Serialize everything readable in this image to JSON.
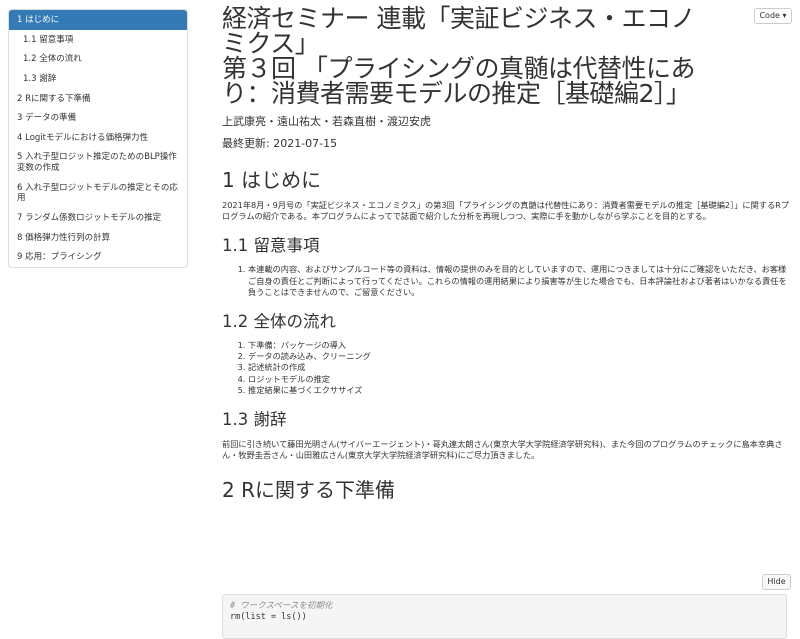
{
  "toc": {
    "items": [
      {
        "label": "1 はじめに",
        "sub": false,
        "active": true
      },
      {
        "label": "1.1 留意事項",
        "sub": true,
        "active": false
      },
      {
        "label": "1.2 全体の流れ",
        "sub": true,
        "active": false
      },
      {
        "label": "1.3 謝辞",
        "sub": true,
        "active": false
      },
      {
        "label": "2 Rに関する下準備",
        "sub": false,
        "active": false
      },
      {
        "label": "3 データの準備",
        "sub": false,
        "active": false
      },
      {
        "label": "4 Logitモデルにおける価格弾力性",
        "sub": false,
        "active": false
      },
      {
        "label": "5 入れ子型ロジット推定のためのBLP操作変数の作成",
        "sub": false,
        "active": false
      },
      {
        "label": "6 入れ子型ロジットモデルの推定とその応用",
        "sub": false,
        "active": false
      },
      {
        "label": "7 ランダム係数ロジットモデルの推定",
        "sub": false,
        "active": false
      },
      {
        "label": "8 価格弾力性行列の計算",
        "sub": false,
        "active": false
      },
      {
        "label": "9 応用：プライシング",
        "sub": false,
        "active": false
      }
    ]
  },
  "header": {
    "title_line1": "経済セミナー 連載「実証ビジネス・エコノ",
    "title_line2": "ミクス」",
    "title_line3": "第３回 「プライシングの真髄は代替性にあ",
    "title_line4": "り：消費者需要モデルの推定［基礎編2］」",
    "authors": "上武康亮・遠山祐太・若森直樹・渡辺安虎",
    "date": "最終更新: 2021-07-15"
  },
  "code_button": "Code ▾",
  "sections": {
    "s1_title": "1 はじめに",
    "s1_body": "2021年8月・9月号の「実証ビジネス・エコノミクス」の第3回「プライシングの真髄は代替性にあり：消費者需要モデルの推定［基礎編2］」に関するRプログラムの紹介である。本プログラムによってで誌面で紹介した分析を再現しつつ、実際に手を動かしながら学ぶことを目的とする。",
    "s11_title": "1.1 留意事項",
    "s11_items": [
      "本連載の内容、およびサンプルコード等の資料は、情報の提供のみを目的としていますので、運用につきましては十分にご確認をいただき、お客様ご自身の責任とご判断によって行ってください。これらの情報の運用結果により損害等が生じた場合でも、日本評論社および著者はいかなる責任を負うことはできませんので、ご留意ください。"
    ],
    "s12_title": "1.2 全体の流れ",
    "s12_items": [
      "下準備：パッケージの導入",
      "データの読み込み、クリーニング",
      "記述統計の作成",
      "ロジットモデルの推定",
      "推定結果に基づくエクササイズ"
    ],
    "s13_title": "1.3 謝辞",
    "s13_body": "前回に引き続いて藤田光明さん(サイバーエージェント)・哥丸連太朗さん(東京大学大学院経済学研究科)、また今回のプログラムのチェックに島本幸典さん・牧野圭吾さん・山田雅広さん(東京大学大学院経済学研究科)にご尽力頂きました。",
    "s2_title": "2 Rに関する下準備"
  },
  "hide_button": "Hide",
  "code": {
    "comment": "# ワークスペースを初期化",
    "line": "rm(list = ls())"
  }
}
